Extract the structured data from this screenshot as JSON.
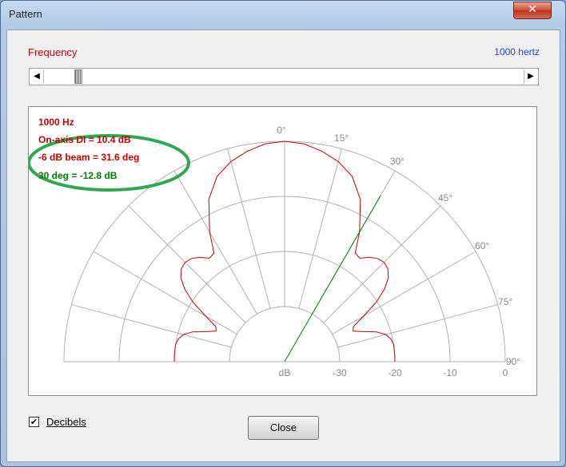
{
  "window": {
    "title": "Pattern",
    "close_glyph": "✕",
    "close_icon": "close-icon"
  },
  "frequency": {
    "label": "Frequency",
    "value_text": "1000 hertz",
    "slider_fraction": 0.03
  },
  "scroll": {
    "left_glyph": "◀",
    "right_glyph": "▶"
  },
  "info_lines": [
    {
      "text": "1000 Hz",
      "color": "#cc0000"
    },
    {
      "text": "On-axis DI = 10.4 dB",
      "color": "#cc0000"
    },
    {
      "text": "-6 dB beam = 31.6 deg",
      "color": "#cc0000"
    },
    {
      "text": "30 deg = -12.8 dB",
      "color": "#008000"
    }
  ],
  "chart_data": {
    "type": "polar",
    "angle_ticks": [
      {
        "deg": 0,
        "label": "0°"
      },
      {
        "deg": 15,
        "label": "15°"
      },
      {
        "deg": 30,
        "label": "30°"
      },
      {
        "deg": 45,
        "label": "45°"
      },
      {
        "deg": 60,
        "label": "60°"
      },
      {
        "deg": 75,
        "label": "75°"
      },
      {
        "deg": 90,
        "label": "90°"
      }
    ],
    "radial_ticks": [
      {
        "db": -40,
        "label": "dB"
      },
      {
        "db": -30,
        "label": "-30"
      },
      {
        "db": -20,
        "label": "-20"
      },
      {
        "db": -10,
        "label": "-10"
      },
      {
        "db": 0,
        "label": "0"
      }
    ],
    "radial_range": [
      -40,
      0
    ],
    "angle_range": [
      -90,
      90
    ],
    "grid_color": "#b0b0b0",
    "series": [
      {
        "color": "#cc0000",
        "points": [
          [
            0,
            0
          ],
          [
            5,
            -0.3
          ],
          [
            10,
            -1.2
          ],
          [
            15,
            -2.4
          ],
          [
            20,
            -4.2
          ],
          [
            25,
            -7.5
          ],
          [
            30,
            -12.8
          ],
          [
            33,
            -16.5
          ],
          [
            36,
            -16.8
          ],
          [
            39,
            -15.6
          ],
          [
            42,
            -14.8
          ],
          [
            45,
            -14.5
          ],
          [
            48,
            -14.8
          ],
          [
            51,
            -15.8
          ],
          [
            54,
            -17.6
          ],
          [
            57,
            -20.2
          ],
          [
            60,
            -23.5
          ],
          [
            63,
            -26.0
          ],
          [
            66,
            -26.4
          ],
          [
            69,
            -24.8
          ],
          [
            72,
            -22.5
          ],
          [
            75,
            -21.0
          ],
          [
            78,
            -20.3
          ],
          [
            81,
            -20.0
          ],
          [
            84,
            -20.0
          ],
          [
            87,
            -20.0
          ],
          [
            90,
            -20.0
          ]
        ]
      }
    ],
    "marker": {
      "angle_deg": 30,
      "color": "#008000"
    }
  },
  "decibels": {
    "label": "Decibels",
    "checked": true,
    "check_glyph": "✔"
  },
  "close_button": {
    "label": "Close"
  }
}
